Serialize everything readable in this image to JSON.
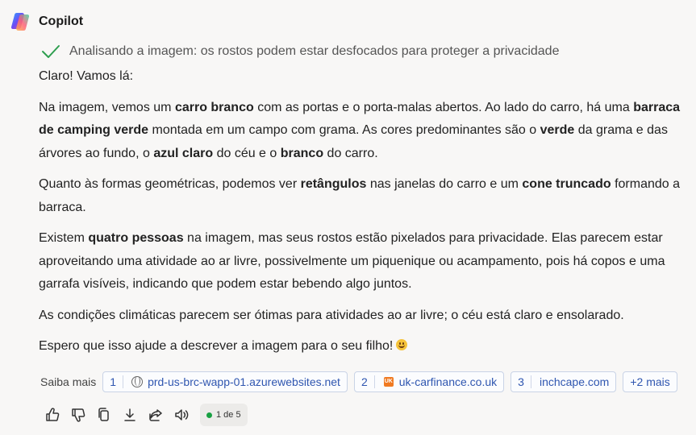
{
  "app": {
    "name": "Copilot"
  },
  "status": {
    "text": "Analisando a imagem: os rostos podem estar desfocados para proteger a privacidade",
    "check_color": "#2e9e4f"
  },
  "message": {
    "intro": "Claro! Vamos lá:",
    "p1": {
      "a": "Na imagem, vemos um ",
      "b1": "carro branco",
      "c": " com as portas e o porta-malas abertos. Ao lado do carro, há uma ",
      "b2": "barraca de camping verde",
      "d": " montada em um campo com grama. As cores predominantes são o ",
      "b3": "verde",
      "e": " da grama e das árvores ao fundo, o ",
      "b4": "azul claro",
      "f": " do céu e o ",
      "b5": "branco",
      "g": " do carro."
    },
    "p2": {
      "a": "Quanto às formas geométricas, podemos ver ",
      "b1": "retângulos",
      "c": " nas janelas do carro e um ",
      "b2": "cone truncado",
      "d": " formando a barraca."
    },
    "p3": {
      "a": "Existem ",
      "b1": "quatro pessoas",
      "c": " na imagem, mas seus rostos estão pixelados para privacidade. Elas parecem estar aproveitando uma atividade ao ar livre, possivelmente um piquenique ou acampamento, pois há copos e uma garrafa visíveis, indicando que podem estar bebendo algo juntos."
    },
    "p4": "As condições climáticas parecem ser ótimas para atividades ao ar livre; o céu está claro e ensolarado.",
    "p5": "Espero que isso ajude a descrever a imagem para o seu filho!",
    "emoji": "smiling-face-icon"
  },
  "sources": {
    "label": "Saiba mais",
    "items": [
      {
        "num": "1",
        "icon": "globe-icon",
        "text": "prd-us-brc-wapp-01.azurewebsites.net"
      },
      {
        "num": "2",
        "icon": "uk-carfinance-favicon",
        "favicon_text": "UK",
        "text": "uk-carfinance.co.uk"
      },
      {
        "num": "3",
        "text": "inchcape.com"
      }
    ],
    "more": "+2 mais"
  },
  "actions": {
    "icons": [
      "thumbs-up-icon",
      "thumbs-down-icon",
      "copy-icon",
      "download-icon",
      "share-icon",
      "read-aloud-icon"
    ],
    "counter": "1 de 5"
  },
  "colors": {
    "link": "#2f56b0",
    "background": "#f8f7f6",
    "counter_dot": "#18a042"
  }
}
